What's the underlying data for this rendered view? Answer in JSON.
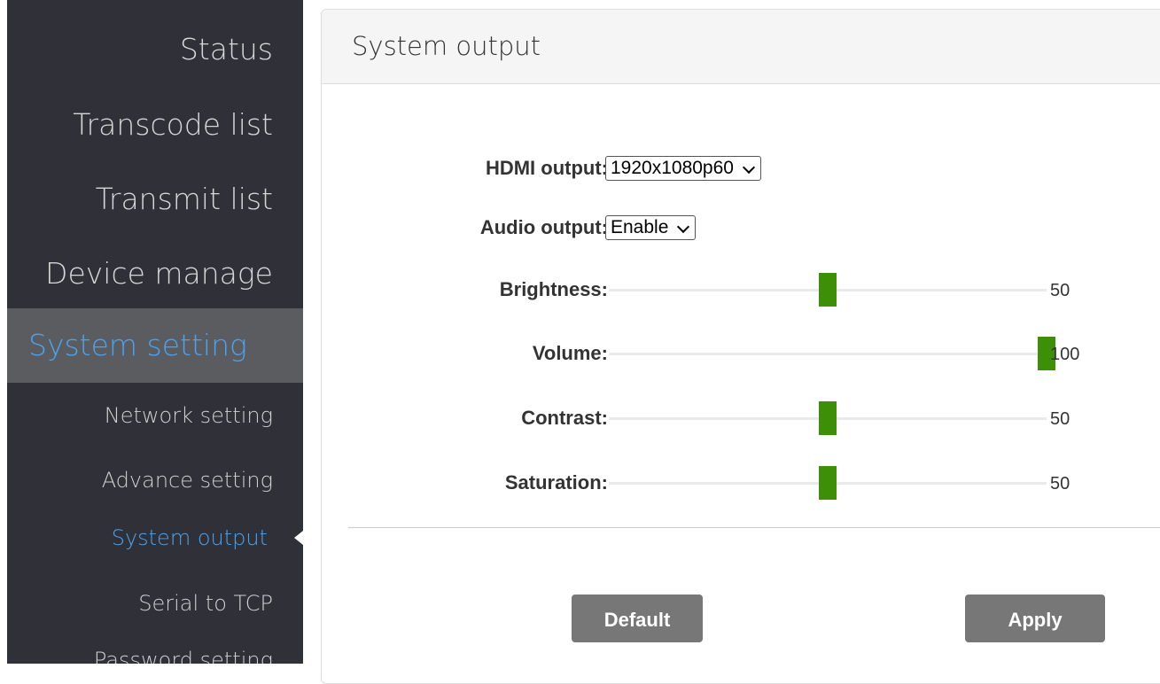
{
  "sidebar": {
    "items": [
      {
        "label": "Status"
      },
      {
        "label": "Transcode list"
      },
      {
        "label": "Transmit list"
      },
      {
        "label": "Device manage"
      },
      {
        "label": "System setting"
      },
      {
        "label": "Network setting"
      },
      {
        "label": "Advance setting"
      },
      {
        "label": "System output"
      },
      {
        "label": "Serial to TCP"
      },
      {
        "label": "Password setting"
      }
    ],
    "active_section": "System setting",
    "active_page": "System output"
  },
  "panel": {
    "title": "System output",
    "hdmi": {
      "label": "HDMI output:",
      "value": "1920x1080p60"
    },
    "audio": {
      "label": "Audio output:",
      "value": "Enable"
    },
    "sliders": [
      {
        "label": "Brightness:",
        "value": "50",
        "level": 50
      },
      {
        "label": "Volume:",
        "value": "100",
        "level": 100
      },
      {
        "label": "Contrast:",
        "value": "50",
        "level": 50
      },
      {
        "label": "Saturation:",
        "value": "50",
        "level": 50
      }
    ],
    "buttons": {
      "default_label": "Default",
      "apply_label": "Apply"
    }
  },
  "colors": {
    "sidebar_bg": "#2f3038",
    "active_text": "#4aa3f0",
    "slider_thumb": "#3d8f07",
    "button_bg": "#777777"
  }
}
